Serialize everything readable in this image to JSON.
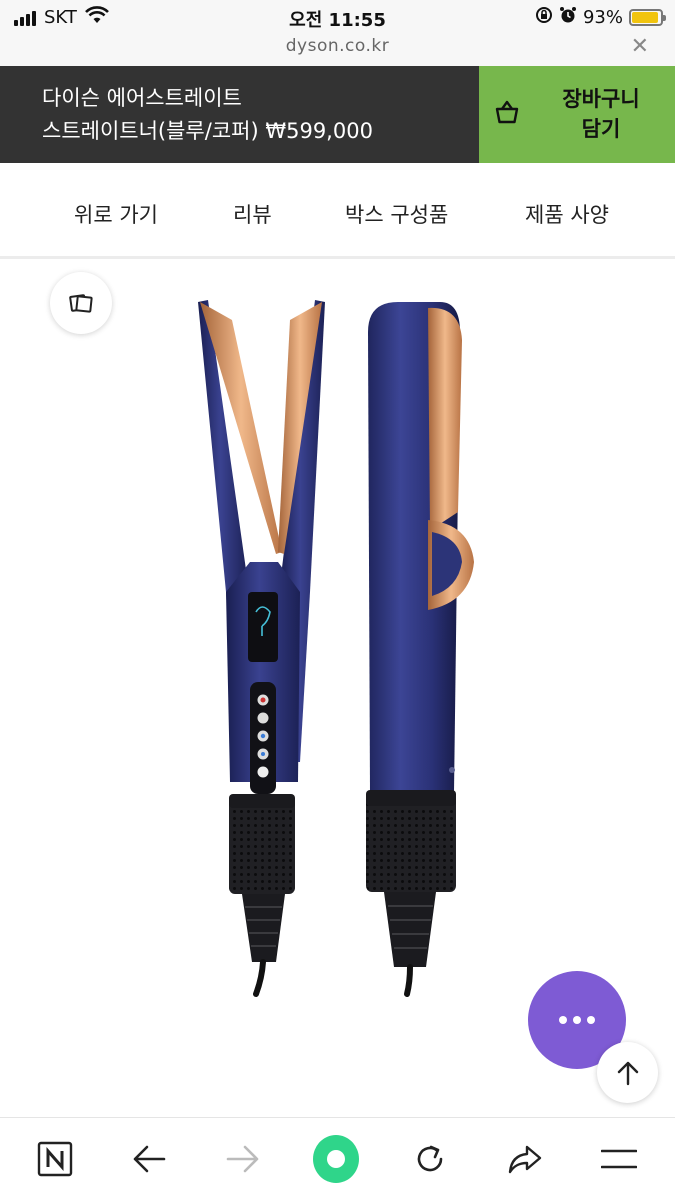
{
  "status_bar": {
    "carrier": "SKT",
    "time": "오전 11:55",
    "battery": "93%",
    "battery_level": 0.93,
    "icons": [
      "signal-icon",
      "wifi-icon",
      "orientation-lock-icon",
      "alarm-icon",
      "battery-icon"
    ]
  },
  "browser": {
    "url": "dyson.co.kr",
    "close_icon": "close-icon"
  },
  "product_bar": {
    "name_line1": "다이슨 에어스트레이트",
    "name_line2": "스트레이트너(블루/코퍼) ₩599,000",
    "cart_line1": "장바구니",
    "cart_line2": "담기",
    "colors": {
      "bar": "#333333",
      "cart": "#77b74c"
    }
  },
  "tabs": [
    {
      "label": "위로 가기"
    },
    {
      "label": "리뷰"
    },
    {
      "label": "박스 구성품"
    },
    {
      "label": "제품 사양"
    }
  ],
  "product_image": {
    "colors": {
      "body": "#2b3170",
      "accent": "#c8895a",
      "grip": "#1e1e22"
    }
  },
  "floating": {
    "more_color": "#7e5bd4",
    "icons": [
      "gallery-icon",
      "more-icon",
      "arrow-up-icon"
    ]
  },
  "toolbar": {
    "icons": [
      "naver-icon",
      "back-icon",
      "forward-icon",
      "home-dot-icon",
      "reload-icon",
      "share-icon",
      "menu-icon"
    ],
    "forward_disabled": true
  }
}
